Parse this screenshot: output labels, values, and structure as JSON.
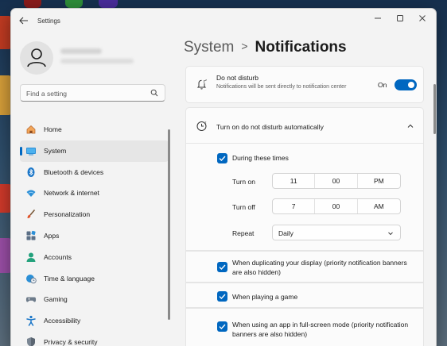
{
  "window": {
    "app_title": "Settings"
  },
  "search": {
    "placeholder": "Find a setting"
  },
  "sidebar": {
    "items": [
      {
        "label": "Home",
        "icon": "home-icon",
        "active": false
      },
      {
        "label": "System",
        "icon": "system-icon",
        "active": true
      },
      {
        "label": "Bluetooth & devices",
        "icon": "bluetooth-icon",
        "active": false
      },
      {
        "label": "Network & internet",
        "icon": "wifi-icon",
        "active": false
      },
      {
        "label": "Personalization",
        "icon": "brush-icon",
        "active": false
      },
      {
        "label": "Apps",
        "icon": "apps-icon",
        "active": false
      },
      {
        "label": "Accounts",
        "icon": "accounts-icon",
        "active": false
      },
      {
        "label": "Time & language",
        "icon": "globe-clock-icon",
        "active": false
      },
      {
        "label": "Gaming",
        "icon": "gamepad-icon",
        "active": false
      },
      {
        "label": "Accessibility",
        "icon": "accessibility-icon",
        "active": false
      },
      {
        "label": "Privacy & security",
        "icon": "shield-icon",
        "active": false
      }
    ]
  },
  "breadcrumb": {
    "parent": "System",
    "separator": ">",
    "current": "Notifications"
  },
  "dnd": {
    "title": "Do not disturb",
    "description": "Notifications will be sent directly to notification center",
    "state_label": "On",
    "on": true
  },
  "auto": {
    "title": "Turn on do not disturb automatically",
    "expanded": true,
    "during_times": {
      "label": "During these times",
      "checked": true
    },
    "turn_on": {
      "label": "Turn on",
      "hour": "11",
      "minute": "00",
      "period": "PM"
    },
    "turn_off": {
      "label": "Turn off",
      "hour": "7",
      "minute": "00",
      "period": "AM"
    },
    "repeat": {
      "label": "Repeat",
      "value": "Daily"
    }
  },
  "options": [
    {
      "label": "When duplicating your display (priority notification banners are also hidden)",
      "checked": true
    },
    {
      "label": "When playing a game",
      "checked": true
    },
    {
      "label": "When using an app in full-screen mode (priority notification banners are also hidden)",
      "checked": true
    }
  ],
  "colors": {
    "accent": "#0067c0",
    "window_bg": "#f3f3f3",
    "card_bg": "#fbfbfb"
  }
}
